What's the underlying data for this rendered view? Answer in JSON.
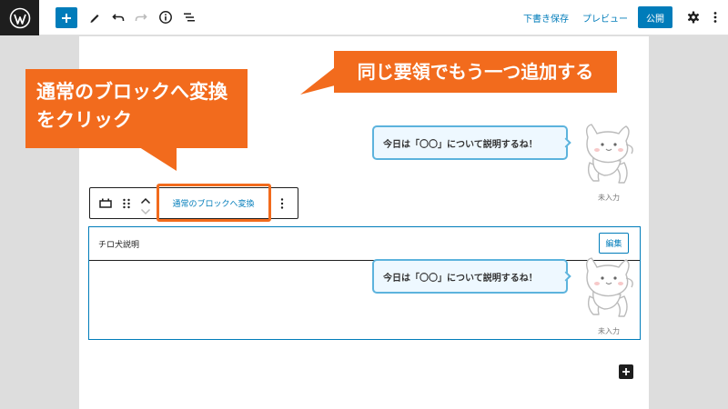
{
  "toolbar": {
    "save_draft": "下書き保存",
    "preview": "プレビュー",
    "publish": "公開"
  },
  "callouts": {
    "instruction_line1": "通常のブロックへ変換",
    "instruction_line2": "をクリック",
    "hint": "同じ要領でもう一つ追加する"
  },
  "bubble": {
    "text": "今日は「〇〇」について説明するね！",
    "avatar_name": "未入力"
  },
  "block_toolbar": {
    "convert_label": "通常のブロックへ変換"
  },
  "reusable_block": {
    "title": "チロ犬説明",
    "edit_label": "編集"
  },
  "colors": {
    "accent": "#007cba",
    "callout": "#f26b1d",
    "bubble_border": "#5cb3dd",
    "bubble_bg": "#eef8ff"
  }
}
